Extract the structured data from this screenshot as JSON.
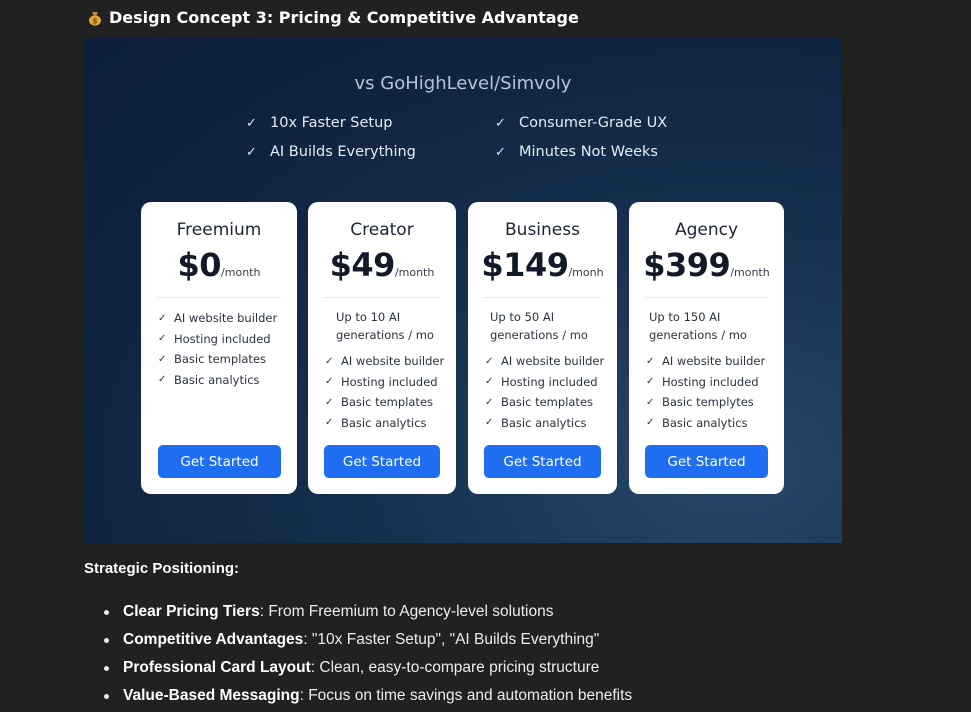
{
  "section": {
    "emoji_icon": "money-bag-icon",
    "title": "Design Concept 3: Pricing & Competitive Advantage"
  },
  "banner": {
    "title": "vs GoHighLevel/Simvoly",
    "advantages": [
      "10x Faster Setup",
      "AI Builds Everything",
      "Consumer-Grade UX",
      "Minutes Not Weeks"
    ]
  },
  "plans": [
    {
      "name": "Freemium",
      "price": "$0",
      "period": "/month",
      "generations": "",
      "features": [
        "AI website builder",
        "Hosting included",
        "Basic templates",
        "Basic analytics"
      ],
      "cta": "Get Started"
    },
    {
      "name": "Creator",
      "price": "$49",
      "period": "/month",
      "generations": "Up to 10 AI generations / mo",
      "features": [
        "AI website builder",
        "Hosting included",
        "Basic templates",
        "Basic analytics"
      ],
      "cta": "Get Started"
    },
    {
      "name": "Business",
      "price": "$149",
      "period": "/monh",
      "generations": "Up to 50 AI generations / mo",
      "features": [
        "AI website builder",
        "Hosting included",
        "Basic templates",
        "Basic analytics"
      ],
      "cta": "Get Started"
    },
    {
      "name": "Agency",
      "price": "$399",
      "period": "/month",
      "generations": "Up to 150 AI generations / mo",
      "features": [
        "AI website builder",
        "Hosting included",
        "Basic templytes",
        "Basic analytics"
      ],
      "cta": "Get Started"
    }
  ],
  "strategy": {
    "heading": "Strategic Positioning:",
    "items": [
      {
        "label": "Clear Pricing Tiers",
        "text": ": From Freemium to Agency-level solutions"
      },
      {
        "label": "Competitive Advantages",
        "text": ": \"10x Faster Setup\", \"AI Builds Everything\""
      },
      {
        "label": "Professional Card Layout",
        "text": ": Clean, easy-to-compare pricing structure"
      },
      {
        "label": "Value-Based Messaging",
        "text": ": Focus on time savings and automation benefits"
      }
    ]
  },
  "colors": {
    "page_bg": "#212121",
    "button": "#1f6ef2",
    "banner": "#0f2340"
  }
}
